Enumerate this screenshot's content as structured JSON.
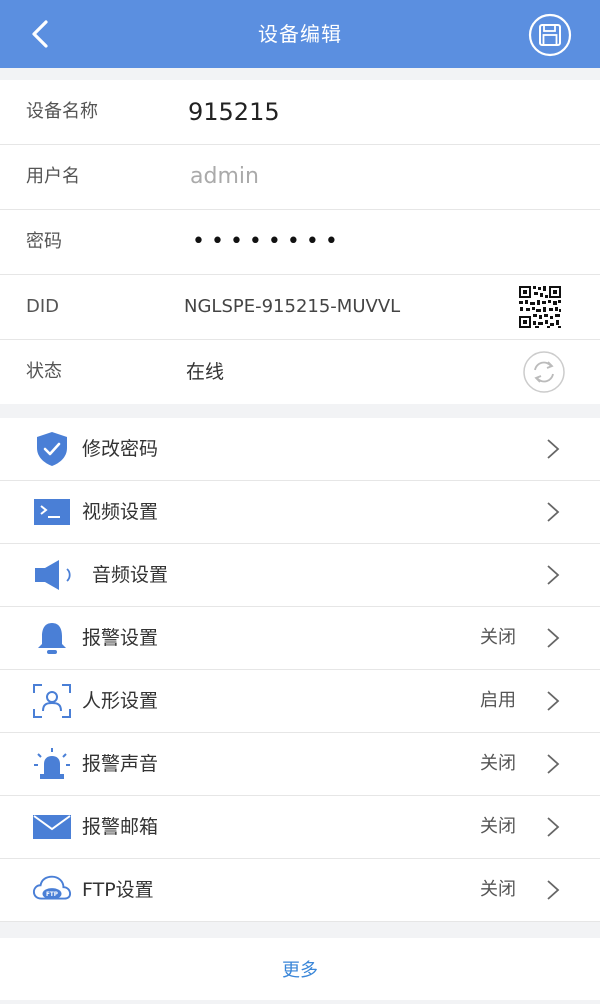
{
  "header": {
    "title": "设备编辑",
    "back_icon": "chevron-left-icon",
    "save_icon": "save-disk-icon",
    "bg_color": "#5b8fe0"
  },
  "info": {
    "name": {
      "label": "设备名称",
      "value": "915215"
    },
    "username": {
      "label": "用户名",
      "value": "admin"
    },
    "password": {
      "label": "密码",
      "value": "••••••••"
    },
    "did": {
      "label": "DID",
      "value": "NGLSPE-915215-MUVVL",
      "icon": "qr-code-icon"
    },
    "status": {
      "label": "状态",
      "value": "在线",
      "icon": "refresh-icon"
    }
  },
  "menu": [
    {
      "label": "修改密码",
      "status": "",
      "icon": "shield-check-icon"
    },
    {
      "label": "视频设置",
      "status": "",
      "icon": "video-terminal-icon"
    },
    {
      "label": "音频设置",
      "status": "",
      "icon": "speaker-icon"
    },
    {
      "label": "报警设置",
      "status": "关闭",
      "icon": "bell-icon"
    },
    {
      "label": "人形设置",
      "status": "启用",
      "icon": "person-detect-icon"
    },
    {
      "label": "报警声音",
      "status": "关闭",
      "icon": "siren-icon"
    },
    {
      "label": "报警邮箱",
      "status": "关闭",
      "icon": "mail-icon"
    },
    {
      "label": "FTP设置",
      "status": "关闭",
      "icon": "ftp-cloud-icon"
    }
  ],
  "more": {
    "label": "更多"
  },
  "colors": {
    "accent": "#4a7fd6",
    "link": "#3a86d8"
  }
}
